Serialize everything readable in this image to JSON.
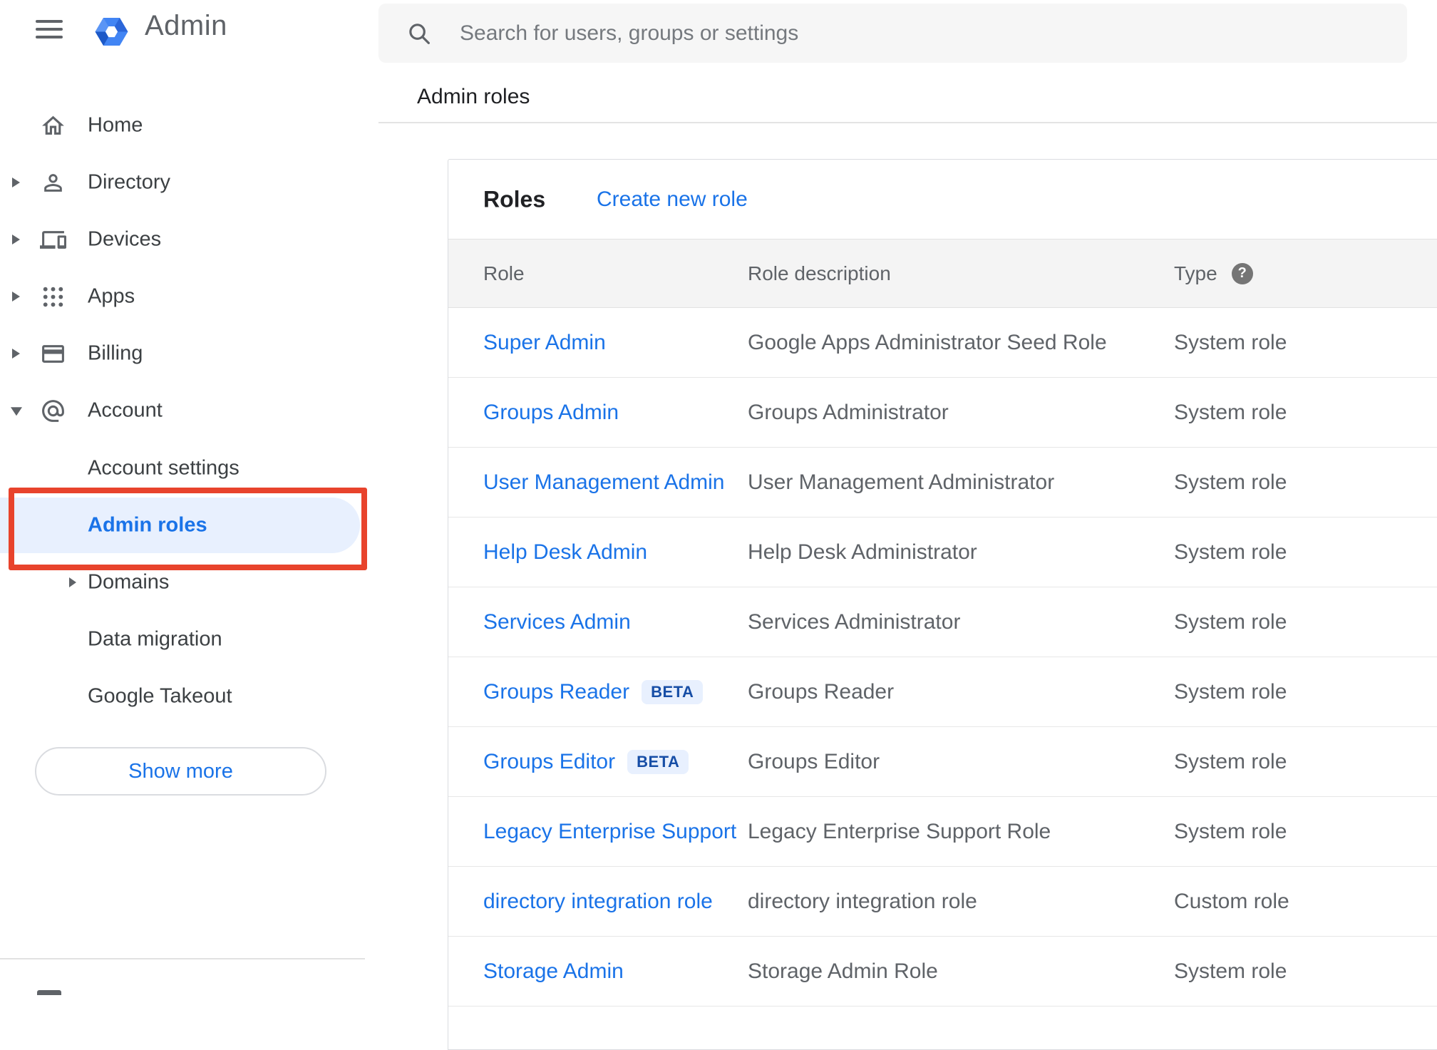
{
  "app": {
    "logo_text": "Admin"
  },
  "topbar": {
    "search_placeholder": "Search for users, groups or settings"
  },
  "page": {
    "title": "Admin roles"
  },
  "sidebar": {
    "items": [
      {
        "label": "Home",
        "icon": "home",
        "expandable": false
      },
      {
        "label": "Directory",
        "icon": "person",
        "expandable": true
      },
      {
        "label": "Devices",
        "icon": "devices",
        "expandable": true
      },
      {
        "label": "Apps",
        "icon": "apps",
        "expandable": true
      },
      {
        "label": "Billing",
        "icon": "billing-card",
        "expandable": true
      },
      {
        "label": "Account",
        "icon": "at-sign",
        "expandable": true,
        "expanded": true
      }
    ],
    "account_children": [
      {
        "label": "Account settings"
      },
      {
        "label": "Admin roles",
        "selected": true,
        "annotated": true
      },
      {
        "label": "Domains",
        "expandable": true
      },
      {
        "label": "Data migration"
      },
      {
        "label": "Google Takeout"
      }
    ],
    "show_more_label": "Show more"
  },
  "roles_panel": {
    "title": "Roles",
    "create_link": "Create new role",
    "columns": {
      "role": "Role",
      "description": "Role description",
      "type": "Type"
    },
    "help_icon_glyph": "?",
    "rows": [
      {
        "role": "Super Admin",
        "description": "Google Apps Administrator Seed Role",
        "type": "System role"
      },
      {
        "role": "Groups Admin",
        "description": "Groups Administrator",
        "type": "System role"
      },
      {
        "role": "User Management Admin",
        "description": "User Management Administrator",
        "type": "System role"
      },
      {
        "role": "Help Desk Admin",
        "description": "Help Desk Administrator",
        "type": "System role"
      },
      {
        "role": "Services Admin",
        "description": "Services Administrator",
        "type": "System role"
      },
      {
        "role": "Groups Reader",
        "badge": "BETA",
        "description": "Groups Reader",
        "type": "System role"
      },
      {
        "role": "Groups Editor",
        "badge": "BETA",
        "description": "Groups Editor",
        "type": "System role"
      },
      {
        "role": "Legacy Enterprise Support",
        "description": "Legacy Enterprise Support Role",
        "type": "System role"
      },
      {
        "role": "directory integration role",
        "description": "directory integration role",
        "type": "Custom role"
      },
      {
        "role": "Storage Admin",
        "description": "Storage Admin Role",
        "type": "System role"
      }
    ]
  },
  "colors": {
    "accent_blue": "#1a73e8",
    "selected_item_bg": "#e8f0fe",
    "beta_badge_bg": "#e8f0fe",
    "beta_badge_text": "#174ea6",
    "annotation_red": "#e8432c",
    "table_header_bg": "#f4f4f4",
    "search_bar_bg": "#f6f6f6",
    "text_primary": "#202124",
    "text_secondary": "#5f6368",
    "logo_blue": "#4285f4"
  }
}
